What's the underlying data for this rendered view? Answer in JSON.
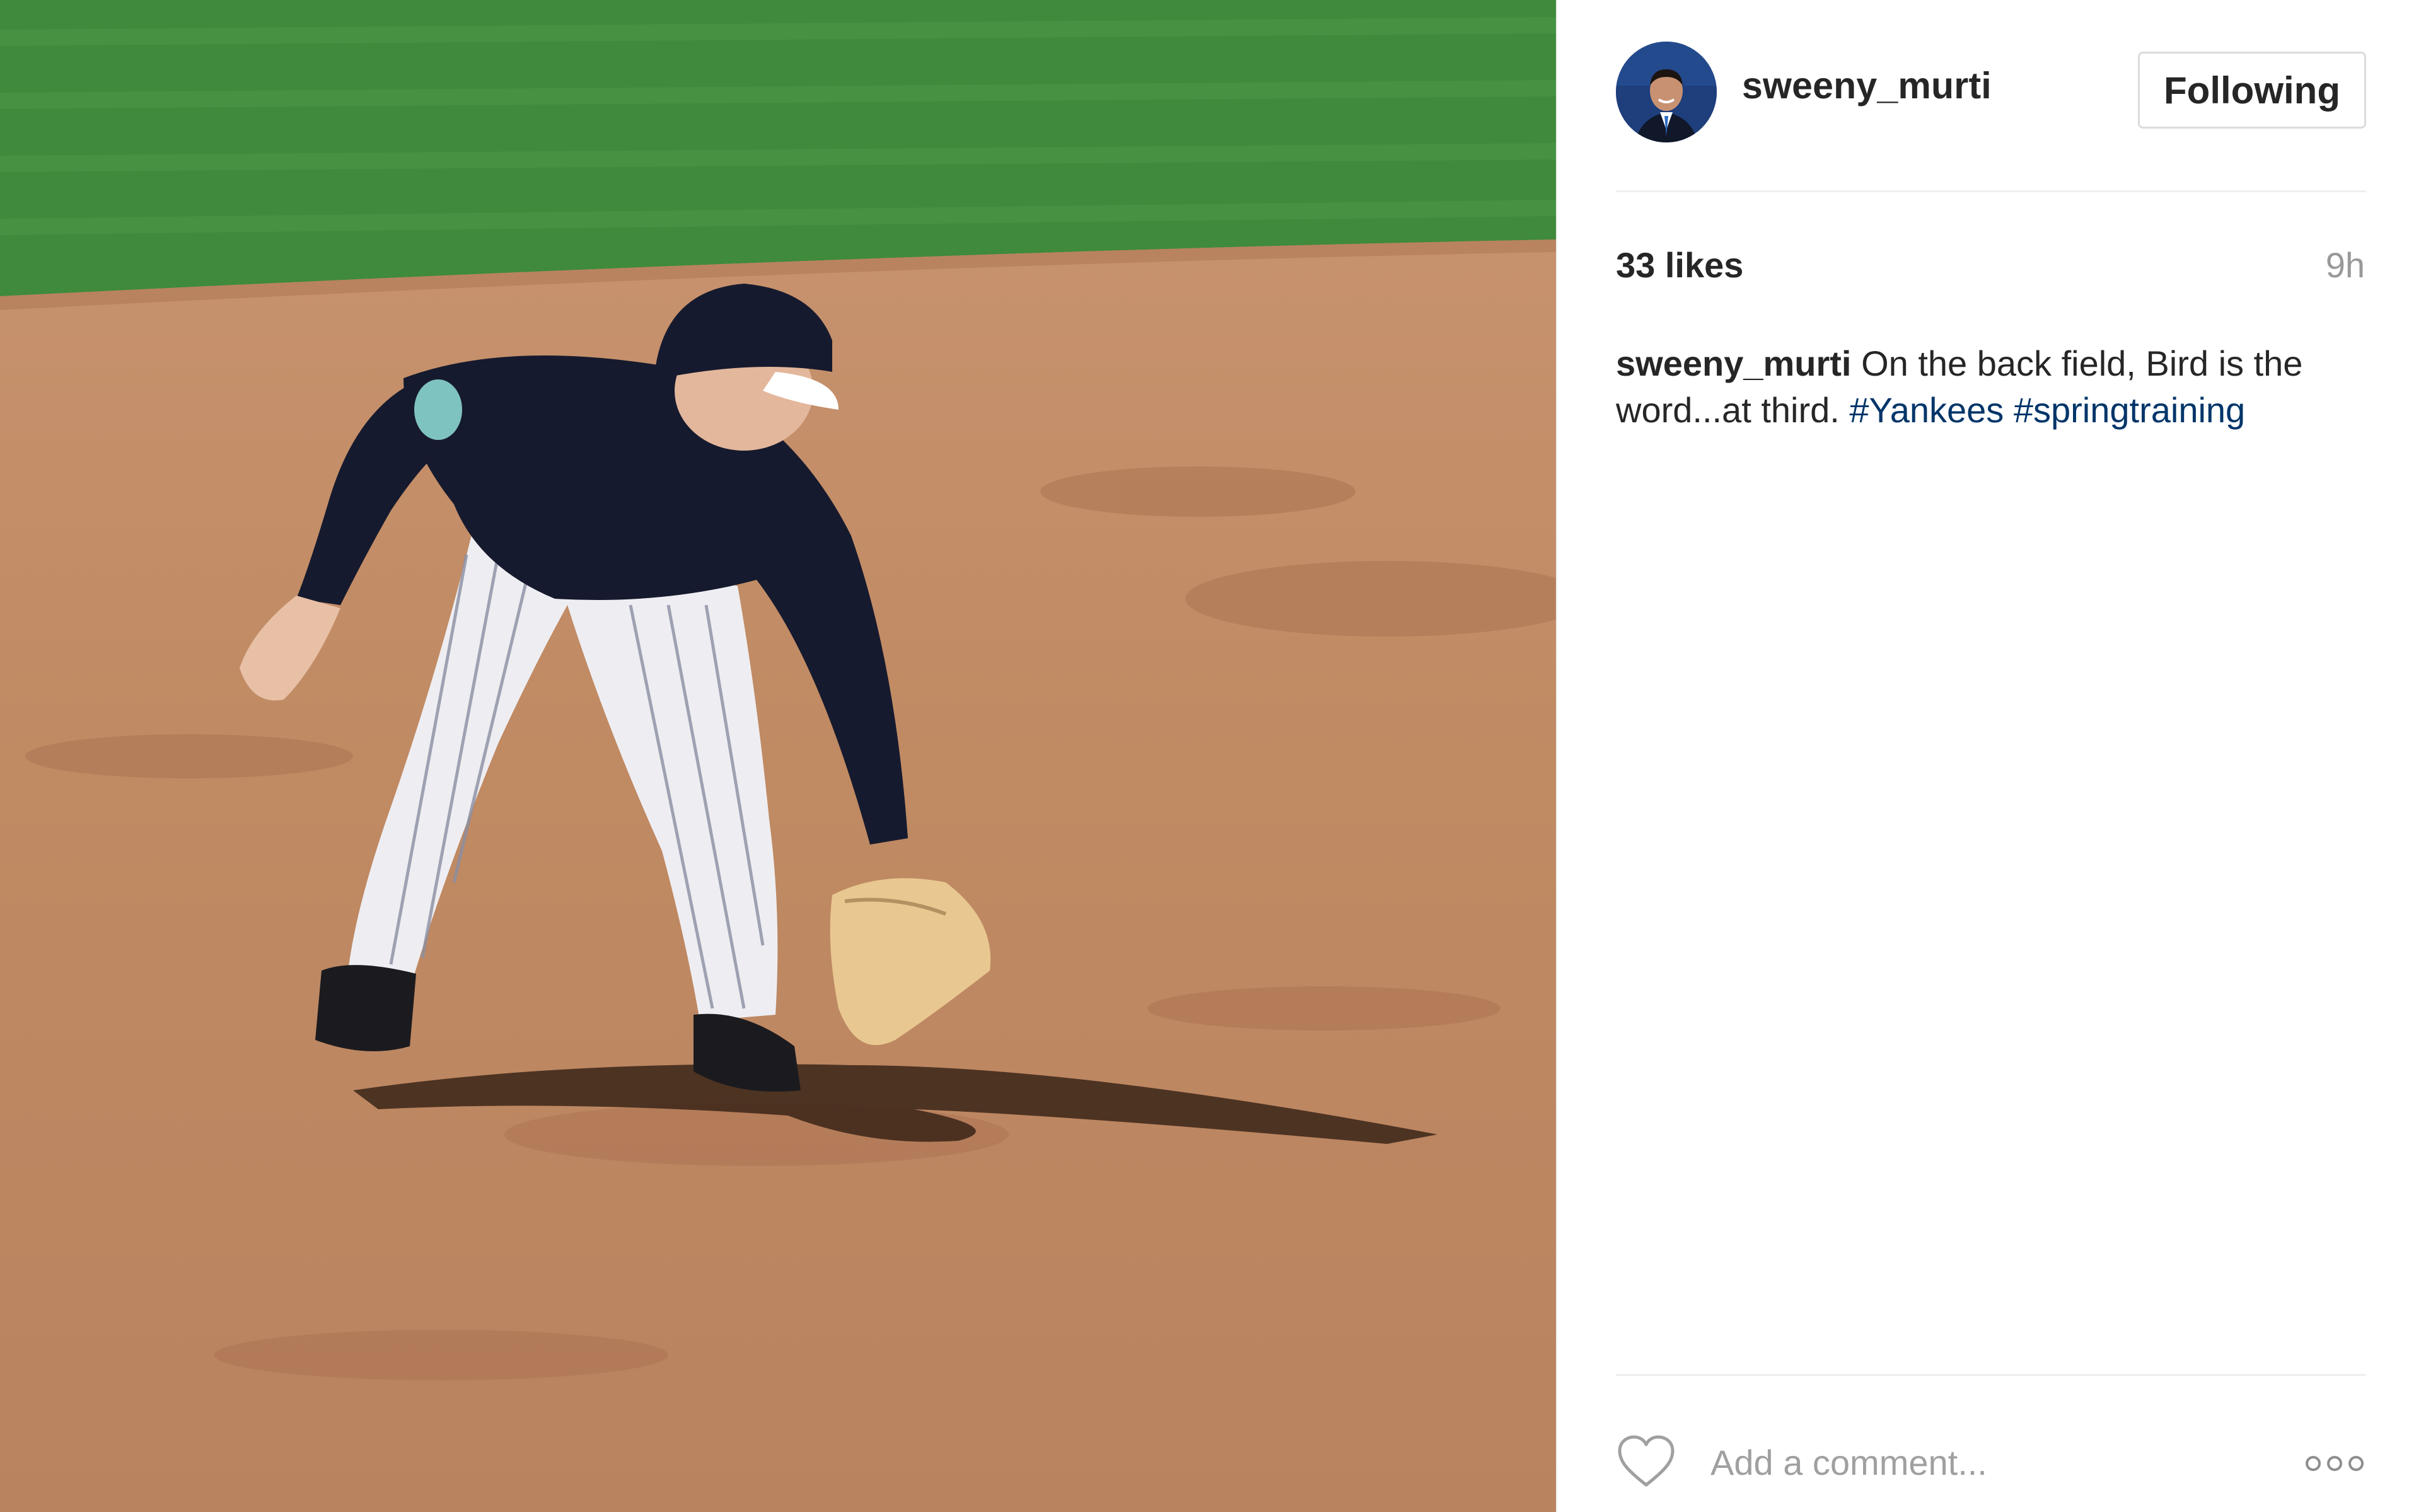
{
  "post": {
    "username": "sweeny_murti",
    "follow_label": "Following",
    "likes": "33 likes",
    "timestamp": "9h",
    "caption": {
      "author": "sweeny_murti",
      "text": "On the back field, Bird is the word...at third.",
      "hashtags": [
        "#Yankees",
        "#springtraining"
      ]
    },
    "comment_placeholder": "Add a comment..."
  },
  "icons": {
    "like": "heart-icon",
    "more": "more-options-icon",
    "avatar": "profile-avatar"
  },
  "colors": {
    "hashtag": "#003569",
    "muted": "#999999",
    "text": "#262626",
    "border": "#dbdbdb"
  }
}
